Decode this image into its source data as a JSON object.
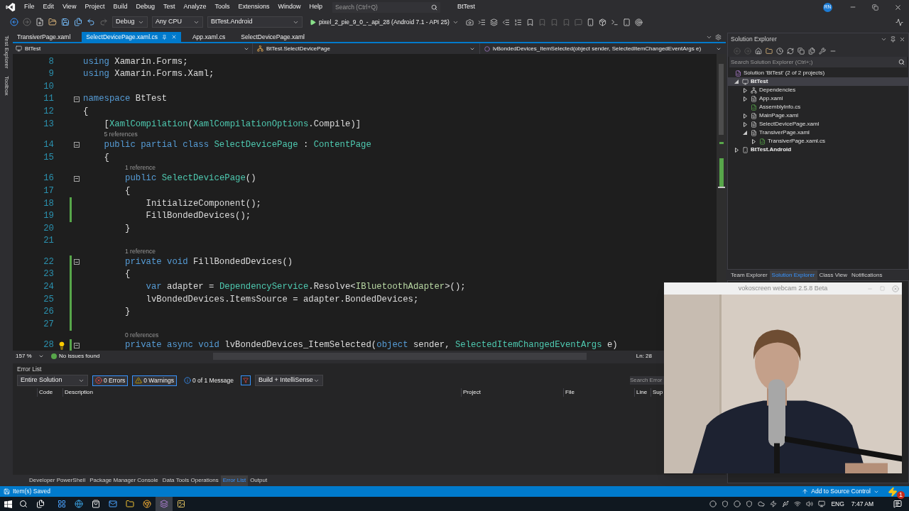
{
  "title_bar": {
    "menu": [
      "File",
      "Edit",
      "View",
      "Project",
      "Build",
      "Debug",
      "Test",
      "Analyze",
      "Tools",
      "Extensions",
      "Window",
      "Help"
    ],
    "search": {
      "placeholder": "Search (Ctrl+Q)"
    },
    "title": "BtTest",
    "avatar": "RN"
  },
  "toolbar": {
    "configuration": "Debug",
    "platform": "Any CPU",
    "startup_project": "BtTest.Android",
    "run_target": "pixel_2_pie_9_0_-_api_28 (Android 7.1 - API 25)"
  },
  "side_strip": [
    "Test Explorer",
    "Toolbox"
  ],
  "editor": {
    "tabs": [
      {
        "label": "TransiverPage.xaml",
        "selected": false
      },
      {
        "label": "SelectDevicePage.xaml.cs",
        "selected": true
      },
      {
        "label": "App.xaml.cs",
        "selected": false
      },
      {
        "label": "SelectDevicePage.xaml",
        "selected": false
      }
    ],
    "nav": {
      "project": "BtTest",
      "class": "BtTest.SelectDevicePage",
      "member": "lvBondedDevices_ItemSelected(object sender, SelectedItemChangedEventArgs e)"
    },
    "lines": [
      {
        "kind": "code",
        "number": "8",
        "changed": false,
        "foldable": false,
        "bulb": false,
        "tokens": [
          {
            "kind": "kw",
            "text": "using "
          },
          {
            "kind": "plain",
            "text": "Xamarin.Forms;"
          }
        ]
      },
      {
        "kind": "code",
        "number": "9",
        "changed": false,
        "foldable": false,
        "bulb": false,
        "tokens": [
          {
            "kind": "kw",
            "text": "using "
          },
          {
            "kind": "plain",
            "text": "Xamarin.Forms.Xaml;"
          }
        ]
      },
      {
        "kind": "code",
        "number": "10",
        "changed": false,
        "foldable": false,
        "bulb": false
      },
      {
        "kind": "code",
        "number": "11",
        "changed": false,
        "foldable": true,
        "bulb": false,
        "tokens": [
          {
            "kind": "kw",
            "text": "namespace "
          },
          {
            "kind": "plain",
            "text": "BtTest"
          }
        ]
      },
      {
        "kind": "code",
        "number": "12",
        "changed": false,
        "foldable": false,
        "bulb": false,
        "tokens": [
          {
            "kind": "plain",
            "text": "{"
          }
        ]
      },
      {
        "kind": "code",
        "number": "13",
        "changed": false,
        "foldable": false,
        "bulb": false,
        "tokens": [
          {
            "kind": "plain",
            "text": "    ["
          },
          {
            "kind": "type",
            "text": "XamlCompilation"
          },
          {
            "kind": "plain",
            "text": "("
          },
          {
            "kind": "type",
            "text": "XamlCompilationOptions"
          },
          {
            "kind": "plain",
            "text": ".Compile)]"
          }
        ]
      },
      {
        "kind": "lens",
        "text": "5 references"
      },
      {
        "kind": "code",
        "number": "14",
        "changed": false,
        "foldable": true,
        "bulb": false,
        "tokens": [
          {
            "kind": "kw",
            "text": "    public partial class "
          },
          {
            "kind": "type",
            "text": "SelectDevicePage"
          },
          {
            "kind": "plain",
            "text": " : "
          },
          {
            "kind": "type",
            "text": "ContentPage"
          }
        ]
      },
      {
        "kind": "code",
        "number": "15",
        "changed": false,
        "foldable": false,
        "bulb": false,
        "tokens": [
          {
            "kind": "plain",
            "text": "    {"
          }
        ]
      },
      {
        "kind": "lens",
        "text": "1 reference"
      },
      {
        "kind": "code",
        "number": "16",
        "changed": false,
        "foldable": true,
        "bulb": false,
        "tokens": [
          {
            "kind": "kw",
            "text": "        public "
          },
          {
            "kind": "type",
            "text": "SelectDevicePage"
          },
          {
            "kind": "plain",
            "text": "()"
          }
        ]
      },
      {
        "kind": "code",
        "number": "17",
        "changed": false,
        "foldable": false,
        "bulb": false,
        "tokens": [
          {
            "kind": "plain",
            "text": "        {"
          }
        ]
      },
      {
        "kind": "code",
        "number": "18",
        "changed": true,
        "foldable": false,
        "bulb": false,
        "tokens": [
          {
            "kind": "plain",
            "text": "            InitializeComponent();"
          }
        ]
      },
      {
        "kind": "code",
        "number": "19",
        "changed": true,
        "foldable": false,
        "bulb": false,
        "tokens": [
          {
            "kind": "plain",
            "text": "            FillBondedDevices();"
          }
        ]
      },
      {
        "kind": "code",
        "number": "20",
        "changed": false,
        "foldable": false,
        "bulb": false,
        "tokens": [
          {
            "kind": "plain",
            "text": "        }"
          }
        ]
      },
      {
        "kind": "code",
        "number": "21",
        "changed": false,
        "foldable": false,
        "bulb": false
      },
      {
        "kind": "lens",
        "text": "1 reference"
      },
      {
        "kind": "code",
        "number": "22",
        "changed": true,
        "foldable": true,
        "bulb": false,
        "tokens": [
          {
            "kind": "kw",
            "text": "        private void "
          },
          {
            "kind": "plain",
            "text": "FillBondedDevices()"
          }
        ]
      },
      {
        "kind": "code",
        "number": "23",
        "changed": true,
        "foldable": false,
        "bulb": false,
        "tokens": [
          {
            "kind": "plain",
            "text": "        {"
          }
        ]
      },
      {
        "kind": "code",
        "number": "24",
        "changed": true,
        "foldable": false,
        "bulb": false,
        "tokens": [
          {
            "kind": "kw",
            "text": "            var "
          },
          {
            "kind": "plain",
            "text": "adapter = "
          },
          {
            "kind": "type",
            "text": "DependencyService"
          },
          {
            "kind": "plain",
            "text": ".Resolve<"
          },
          {
            "kind": "iface",
            "text": "IBluetoothAdapter"
          },
          {
            "kind": "plain",
            "text": ">();"
          }
        ]
      },
      {
        "kind": "code",
        "number": "25",
        "changed": true,
        "foldable": false,
        "bulb": false,
        "tokens": [
          {
            "kind": "plain",
            "text": "            lvBondedDevices.ItemsSource = adapter.BondedDevices;"
          }
        ]
      },
      {
        "kind": "code",
        "number": "26",
        "changed": true,
        "foldable": false,
        "bulb": false,
        "tokens": [
          {
            "kind": "plain",
            "text": "        }"
          }
        ]
      },
      {
        "kind": "code",
        "number": "27",
        "changed": true,
        "foldable": false,
        "bulb": false
      },
      {
        "kind": "lens",
        "text": "0 references"
      },
      {
        "kind": "code",
        "number": "28",
        "changed": true,
        "foldable": true,
        "bulb": true,
        "tokens": [
          {
            "kind": "kw",
            "text": "        private async void "
          },
          {
            "kind": "plain",
            "text": "lvBondedDevices_ItemSelected("
          },
          {
            "kind": "kw",
            "text": "object "
          },
          {
            "kind": "plain",
            "text": "sender, "
          },
          {
            "kind": "type",
            "text": "SelectedItemChangedEventArgs"
          },
          {
            "kind": "plain",
            "text": " e)"
          }
        ]
      }
    ],
    "zoom": "157 %",
    "issues": "No issues found",
    "position": "Ln: 28"
  },
  "error_list": {
    "title": "Error List",
    "scope": "Entire Solution",
    "filters": [
      {
        "kind": "error",
        "label": "0 Errors",
        "selected": true
      },
      {
        "kind": "warning",
        "label": "0 Warnings",
        "selected": true
      },
      {
        "kind": "message",
        "label": "0 of 1 Message",
        "selected": false
      }
    ],
    "source": "Build + IntelliSense",
    "search": {
      "placeholder": "Search Error"
    },
    "columns": [
      "Code",
      "Description",
      "Project",
      "File",
      "Line",
      "Sup"
    ]
  },
  "bottom_tabs": [
    {
      "label": "Developer PowerShell",
      "selected": false
    },
    {
      "label": "Package Manager Console",
      "selected": false
    },
    {
      "label": "Data Tools Operations",
      "selected": false
    },
    {
      "label": "Error List",
      "selected": true
    },
    {
      "label": "Output",
      "selected": false
    }
  ],
  "solution_explorer": {
    "title": "Solution Explorer",
    "search": {
      "placeholder": "Search Solution Explorer (Ctrl+;)"
    },
    "tree": [
      {
        "kind": "solution",
        "label": "Solution 'BtTest' (2 of 2 projects)",
        "selected": false,
        "children": [
          {
            "kind": "project",
            "label": "BtTest",
            "expanded": true,
            "selected": true,
            "children": [
              {
                "kind": "dependencies",
                "label": "Dependencies",
                "expanded": false,
                "selected": false
              },
              {
                "kind": "xaml",
                "label": "App.xaml",
                "expanded": false,
                "selected": false
              },
              {
                "kind": "cs",
                "label": "AssemblyInfo.cs",
                "selected": false
              },
              {
                "kind": "xaml",
                "label": "MainPage.xaml",
                "expanded": false,
                "selected": false
              },
              {
                "kind": "xaml",
                "label": "SelectDevicePage.xaml",
                "expanded": false,
                "selected": false
              },
              {
                "kind": "xaml",
                "label": "TransiverPage.xaml",
                "expanded": true,
                "selected": false,
                "children": [
                  {
                    "kind": "cs",
                    "label": "TransiverPage.xaml.cs",
                    "expanded": false,
                    "selected": false
                  }
                ]
              }
            ]
          },
          {
            "kind": "android",
            "label": "BtTest.Android",
            "expanded": false,
            "selected": false
          }
        ]
      }
    ],
    "tabs": [
      {
        "label": "Team Explorer",
        "selected": false
      },
      {
        "label": "Solution Explorer",
        "selected": true
      },
      {
        "label": "Class View",
        "selected": false
      },
      {
        "label": "Notifications",
        "selected": false
      }
    ]
  },
  "status_bar": {
    "message": "Item(s) Saved",
    "source_control": "Add to Source Control",
    "notification_count": "1"
  },
  "taskbar": {
    "language": "ENG",
    "time": "7:47 AM"
  },
  "webcam": {
    "title": "vokoscreen webcam 2.5.8 Beta",
    "kind": "picture"
  }
}
